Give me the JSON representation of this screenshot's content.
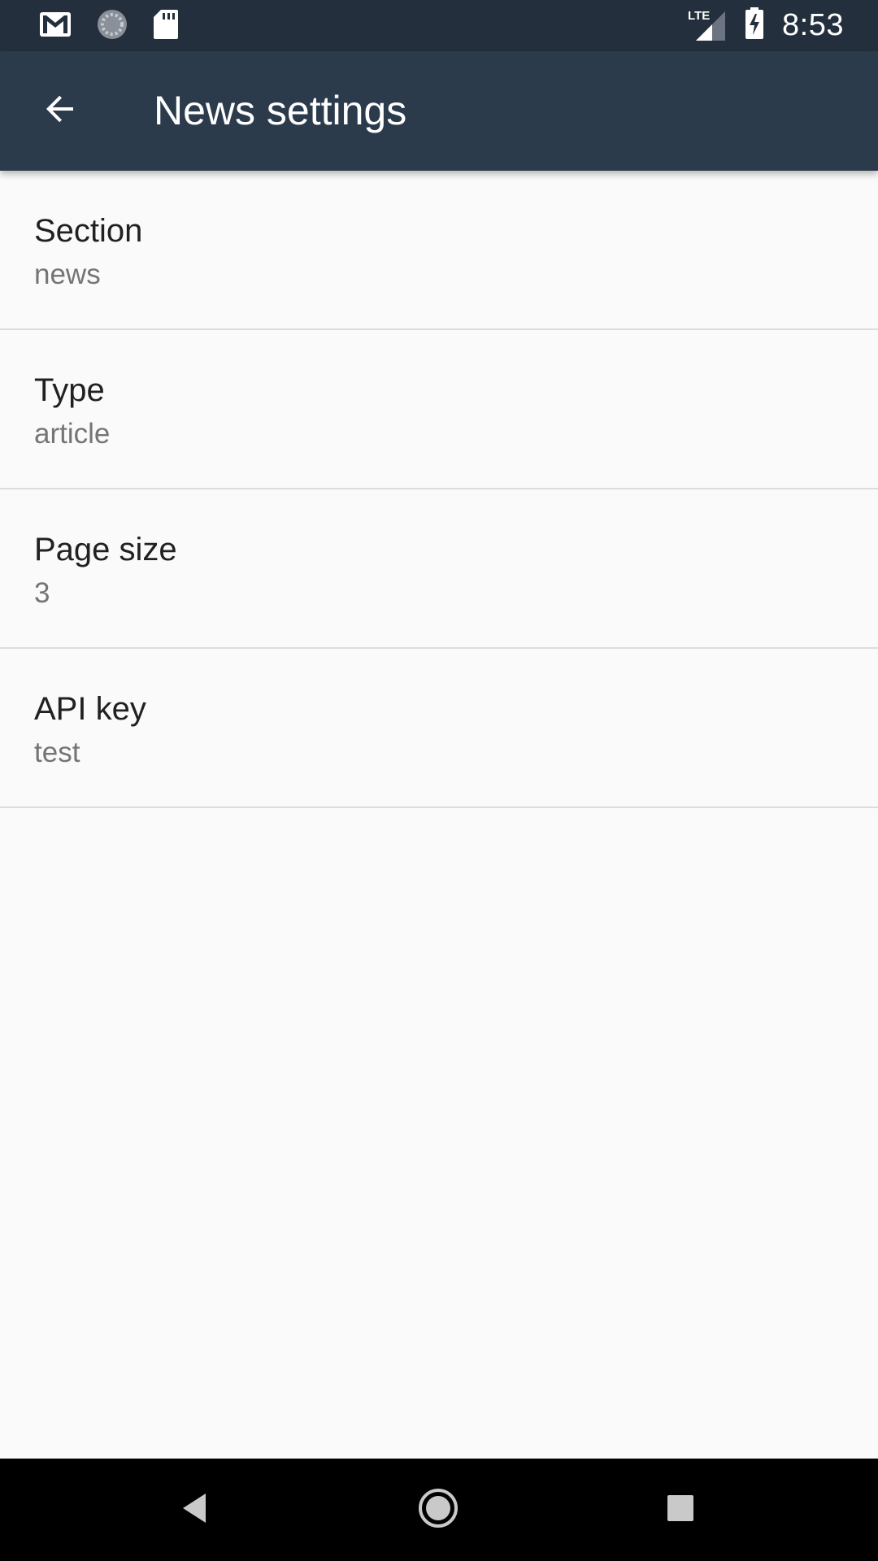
{
  "status_bar": {
    "time": "8:53",
    "network_label": "LTE",
    "icons": [
      "gmail-icon",
      "sync-icon",
      "sd-card-icon",
      "lte-signal-icon",
      "battery-charging-icon"
    ]
  },
  "app_bar": {
    "title": "News settings",
    "back_icon": "arrow-back-icon"
  },
  "settings": [
    {
      "title": "Section",
      "summary": "news"
    },
    {
      "title": "Type",
      "summary": "article"
    },
    {
      "title": "Page size",
      "summary": "3"
    },
    {
      "title": "API key",
      "summary": "test"
    }
  ],
  "nav_bar": {
    "icons": [
      "back-triangle-icon",
      "home-circle-icon",
      "recents-square-icon"
    ]
  },
  "colors": {
    "status_bar": "#232f3c",
    "app_bar": "#2c3b4c",
    "background": "#fafafa",
    "divider": "#dcdcdc",
    "title_text": "#212121",
    "summary_text": "#757575"
  }
}
